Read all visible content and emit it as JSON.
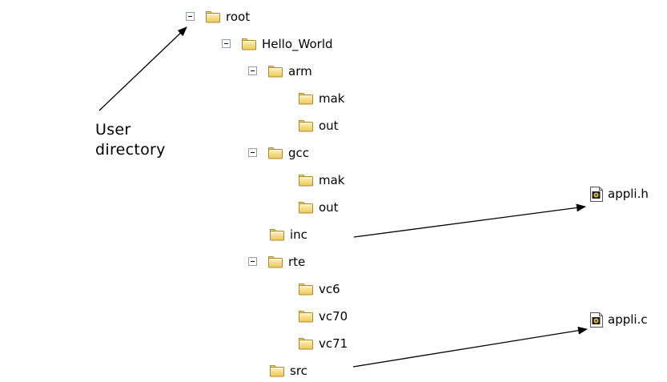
{
  "tree": {
    "root": {
      "label": "root"
    },
    "hello_world": {
      "label": "Hello_World"
    },
    "arm": {
      "label": "arm"
    },
    "arm_mak": {
      "label": "mak"
    },
    "arm_out": {
      "label": "out"
    },
    "gcc": {
      "label": "gcc"
    },
    "gcc_mak": {
      "label": "mak"
    },
    "gcc_out": {
      "label": "out"
    },
    "inc": {
      "label": "inc"
    },
    "rte": {
      "label": "rte"
    },
    "vc6": {
      "label": "vc6"
    },
    "vc70": {
      "label": "vc70"
    },
    "vc71": {
      "label": "vc71"
    },
    "src": {
      "label": "src"
    }
  },
  "files": {
    "header": {
      "label": "appli.h"
    },
    "source": {
      "label": "appli.c"
    }
  },
  "callout": {
    "line1": "User",
    "line2": "directory"
  },
  "colors": {
    "folder_fill": "#f6dc82",
    "folder_stroke": "#b08a2a",
    "toggle_border": "#8f9daa"
  }
}
